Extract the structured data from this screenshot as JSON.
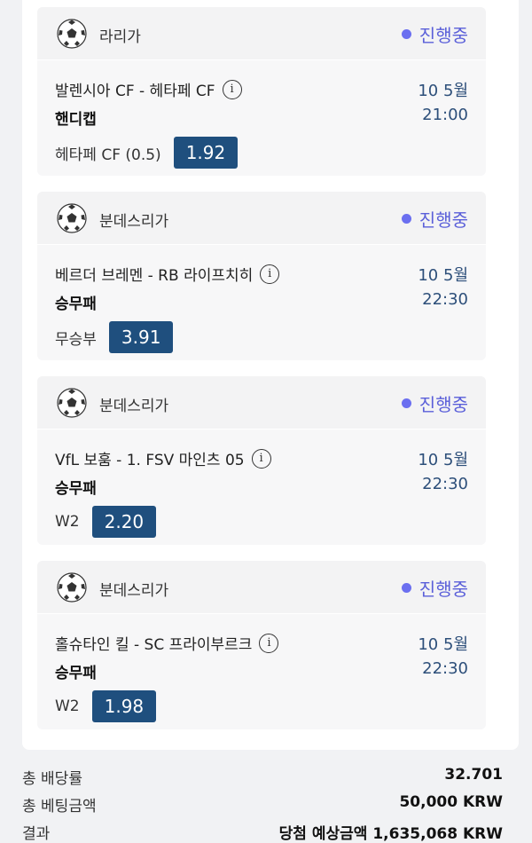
{
  "status_color": "#5a5fd9",
  "odds_color": "#1f4f7e",
  "bets": [
    {
      "league": "라리가",
      "status": "진행중",
      "match": "발렌시아 CF - 헤타페 CF",
      "market": "핸디캡",
      "date": "10 5월",
      "time": "21:00",
      "pick": "헤타페 CF (0.5)",
      "odds": "1.92"
    },
    {
      "league": "분데스리가",
      "status": "진행중",
      "match": "베르더 브레멘 - RB 라이프치히",
      "market": "승무패",
      "date": "10 5월",
      "time": "22:30",
      "pick": "무승부",
      "odds": "3.91"
    },
    {
      "league": "분데스리가",
      "status": "진행중",
      "match": "VfL 보훔 - 1. FSV 마인츠 05",
      "market": "승무패",
      "date": "10 5월",
      "time": "22:30",
      "pick": "W2",
      "odds": "2.20"
    },
    {
      "league": "분데스리가",
      "status": "진행중",
      "match": "홀슈타인 킬 - SC 프라이부르크",
      "market": "승무패",
      "date": "10 5월",
      "time": "22:30",
      "pick": "W2",
      "odds": "1.98"
    }
  ],
  "summary": {
    "total_odds_label": "총 배당률",
    "total_odds_value": "32.701",
    "total_stake_label": "총 베팅금액",
    "total_stake_value": "50,000 KRW",
    "result_label": "결과",
    "result_value": "당첨 예상금액 1,635,068 KRW"
  },
  "icons": {
    "sport": "soccer-ball-icon",
    "info": "info-icon"
  }
}
